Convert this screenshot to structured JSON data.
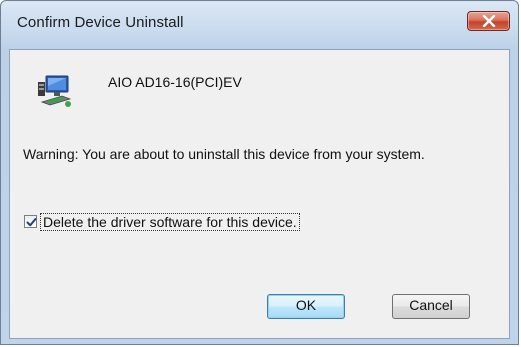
{
  "window": {
    "title": "Confirm Device Uninstall",
    "close_icon": "close-icon"
  },
  "device": {
    "icon": "network-device-icon",
    "name": "AIO AD16-16(PCI)EV"
  },
  "message": {
    "warning": "Warning: You are about to uninstall this device from your system."
  },
  "option": {
    "checked": true,
    "label": "Delete the driver software for this device."
  },
  "buttons": {
    "ok_label": "OK",
    "cancel_label": "Cancel"
  },
  "colors": {
    "frame": "#bfd3ea",
    "client": "#f0f0f0",
    "close_button": "#c2432b",
    "ok_highlight": "#3c7fb1"
  }
}
